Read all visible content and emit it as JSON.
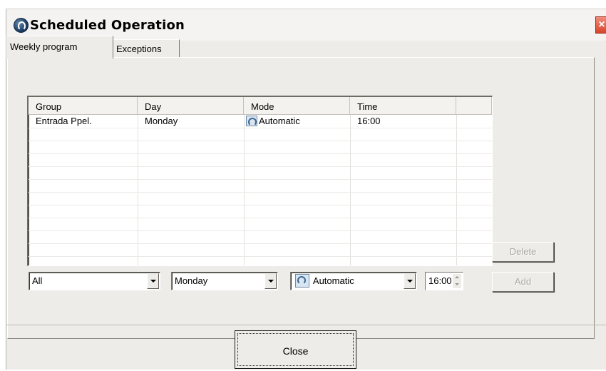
{
  "window": {
    "title": "Scheduled Operation",
    "close_glyph": "×"
  },
  "tabs": [
    {
      "label": "Weekly program",
      "active": true
    },
    {
      "label": "Exceptions",
      "active": false
    }
  ],
  "grid": {
    "columns": [
      "Group",
      "Day",
      "Mode",
      "Time"
    ],
    "rows": [
      {
        "group": "Entrada Ppel.",
        "day": "Monday",
        "mode": "Automatic",
        "time": "16:00"
      }
    ]
  },
  "editor": {
    "group": "All",
    "day": "Monday",
    "mode": "Automatic",
    "time": "16:00"
  },
  "buttons": {
    "delete": "Delete",
    "add": "Add",
    "close": "Close"
  }
}
